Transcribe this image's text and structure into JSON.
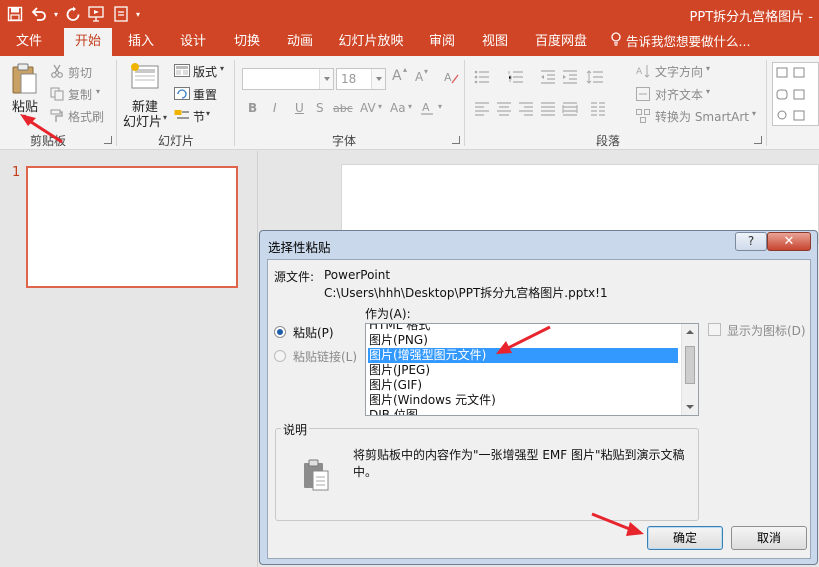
{
  "window": {
    "title": "PPT拆分九宫格图片 -"
  },
  "quick_access": {
    "icons": [
      "save-icon",
      "undo-icon",
      "redo-icon",
      "start-from-beginning-icon",
      "touch-mode-icon",
      "customize-qat-icon"
    ]
  },
  "tabs": [
    {
      "label": "文件"
    },
    {
      "label": "开始"
    },
    {
      "label": "插入"
    },
    {
      "label": "设计"
    },
    {
      "label": "切换"
    },
    {
      "label": "动画"
    },
    {
      "label": "幻灯片放映"
    },
    {
      "label": "审阅"
    },
    {
      "label": "视图"
    },
    {
      "label": "百度网盘"
    }
  ],
  "tell_me": "告诉我您想要做什么...",
  "ribbon": {
    "clipboard": {
      "paste": "粘贴",
      "cut": "剪切",
      "copy": "复制",
      "format_painter": "格式刷",
      "group_label": "剪贴板"
    },
    "slides": {
      "new_slide_line1": "新建",
      "new_slide_line2": "幻灯片",
      "layout": "版式",
      "reset": "重置",
      "section": "节",
      "group_label": "幻灯片"
    },
    "font": {
      "font_size": "18",
      "bold": "B",
      "italic": "I",
      "underline": "U",
      "shadow": "S",
      "strikethrough": "abc",
      "spacing": "AV",
      "change_case": "Aa",
      "grow": "A",
      "shrink": "A",
      "group_label": "字体"
    },
    "paragraph": {
      "text_direction": "文字方向",
      "align_text": "对齐文本",
      "convert_smartart": "转换为 SmartArt",
      "group_label": "段落"
    }
  },
  "thumbnails": {
    "slide_number": "1"
  },
  "dialog": {
    "title": "选择性粘贴",
    "help": "?",
    "close": "✕",
    "source_label": "源文件:",
    "source_app": "PowerPoint",
    "source_path": "C:\\Users\\hhh\\Desktop\\PPT拆分九宫格图片.pptx!1",
    "as_label": "作为(A):",
    "paste_option": "粘贴(P)",
    "paste_link_option": "粘贴链接(L)",
    "display_as_icon": "显示为图标(D)",
    "formats": [
      {
        "label": "HTML 格式",
        "selected": false
      },
      {
        "label": "图片(PNG)",
        "selected": false
      },
      {
        "label": "图片(增强型图元文件)",
        "selected": true
      },
      {
        "label": "图片(JPEG)",
        "selected": false
      },
      {
        "label": "图片(GIF)",
        "selected": false
      },
      {
        "label": "图片(Windows 元文件)",
        "selected": false
      },
      {
        "label": "DIB 位图",
        "selected": false
      }
    ],
    "description_legend": "说明",
    "description_text": "将剪贴板中的内容作为\"一张增强型 EMF 图片\"粘贴到演示文稿中。",
    "ok": "确定",
    "cancel": "取消"
  },
  "colors": {
    "accent": "#d04526",
    "annotation_arrow": "#e8242c",
    "selection": "#3399ff"
  }
}
